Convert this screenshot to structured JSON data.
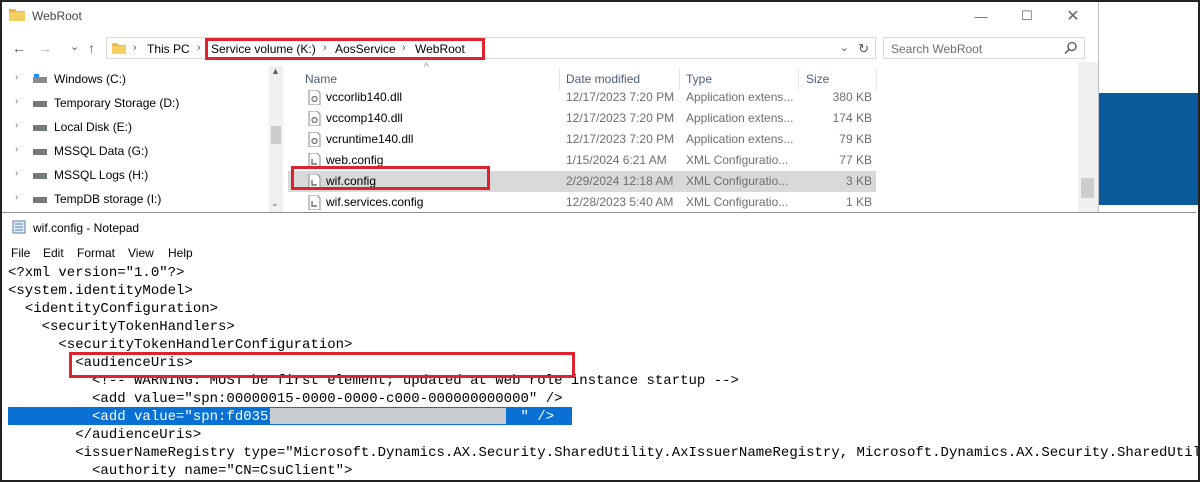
{
  "explorer": {
    "title": "WebRoot",
    "nav": {
      "back": "←",
      "forward": "→",
      "recent": "⌄",
      "up": "↑"
    },
    "breadcrumb": [
      "This PC",
      "Service volume (K:)",
      "AosService",
      "WebRoot"
    ],
    "search_placeholder": "Search WebRoot",
    "columns": {
      "name": "Name",
      "date": "Date modified",
      "type": "Type",
      "size": "Size"
    },
    "tree": [
      {
        "label": "Windows (C:)"
      },
      {
        "label": "Temporary Storage (D:)"
      },
      {
        "label": "Local Disk (E:)"
      },
      {
        "label": "MSSQL Data (G:)"
      },
      {
        "label": "MSSQL Logs (H:)"
      },
      {
        "label": "TempDB storage (I:)"
      }
    ],
    "files": [
      {
        "name": "vccorlib140.dll",
        "date": "12/17/2023 7:20 PM",
        "type": "Application extens...",
        "size": "380 KB"
      },
      {
        "name": "vccomp140.dll",
        "date": "12/17/2023 7:20 PM",
        "type": "Application extens...",
        "size": "174 KB"
      },
      {
        "name": "vcruntime140.dll",
        "date": "12/17/2023 7:20 PM",
        "type": "Application extens...",
        "size": "79 KB"
      },
      {
        "name": "web.config",
        "date": "1/15/2024 6:21 AM",
        "type": "XML Configuratio...",
        "size": "77 KB"
      },
      {
        "name": "wif.config",
        "date": "2/29/2024 12:18 AM",
        "type": "XML Configuratio...",
        "size": "3 KB"
      },
      {
        "name": "wif.services.config",
        "date": "12/28/2023 5:40 AM",
        "type": "XML Configuratio...",
        "size": "1 KB"
      }
    ],
    "colors": {
      "highlight": "#e0212f",
      "selected_row": "#d9d9d9",
      "header_text": "#4c607a"
    }
  },
  "notepad": {
    "title": "wif.config - Notepad",
    "menu": [
      "File",
      "Edit",
      "Format",
      "View",
      "Help"
    ],
    "lines": [
      "<?xml version=\"1.0\"?>",
      "<system.identityModel>",
      "  <identityConfiguration>",
      "    <securityTokenHandlers>",
      "      <securityTokenHandlerConfiguration>",
      "        <audienceUris>",
      "          <!-- WARNING: MUST be first element; updated at web role instance startup -->",
      "          <add value=\"spn:00000015-0000-0000-c000-000000000000\" />",
      "          <add value=\"spn:fd0351b                            \" />",
      "        </audienceUris>",
      "        <issuerNameRegistry type=\"Microsoft.Dynamics.AX.Security.SharedUtility.AxIssuerNameRegistry, Microsoft.Dynamics.AX.Security.SharedUtility\">",
      "          <authority name=\"CN=CsuClient\">"
    ],
    "selection_color": "#0a71d4"
  }
}
